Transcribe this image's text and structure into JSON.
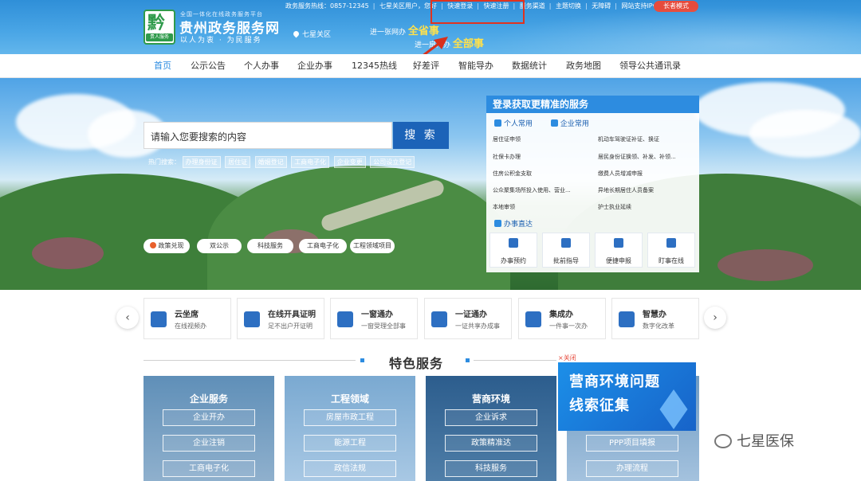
{
  "header": {
    "logo_glyph": "黔",
    "logo_tag": "贵人服务",
    "subtitle": "全国一体化在线政务服务平台",
    "title": "贵州政务服务网",
    "slogan": "以人为衷 · 为民服务",
    "location": "七星关区",
    "slogan_a_prefix": "进一张网办",
    "slogan_a_emph": "全省事",
    "slogan_b_prefix": "进一扇门办",
    "slogan_b_emph": "全部事"
  },
  "topbar": {
    "hotline": "政务服务热线：0857-12345",
    "user": "七星关区用户，您好",
    "quick_login": "快速登录",
    "quick_register": "快速注册",
    "barrier_free": "服务渠道",
    "theme": "主题切换",
    "accessible": "无障碍",
    "ipv6": "网站支持IPv6",
    "elder_mode": "长者模式"
  },
  "nav": [
    "首页",
    "公示公告",
    "个人办事",
    "企业办事",
    "12345热线",
    "好差评",
    "智能导办",
    "数据统计",
    "政务地图",
    "领导公共通讯录"
  ],
  "search": {
    "placeholder": "请输入您要搜索的内容",
    "button": "搜 索",
    "hot_label": "热门搜索：",
    "hot_tags": [
      "办理身份证",
      "居住证",
      "婚姻登记",
      "工商电子化",
      "企业变更",
      "公司设立登记"
    ]
  },
  "pills": [
    "政策兑现",
    "双公示",
    "科技服务",
    "工商电子化",
    "工程领域项目"
  ],
  "panel": {
    "title": "登录获取更精准的服务",
    "tab_personal": "个人常用",
    "tab_company": "企业常用",
    "services_left": [
      "居住证申领",
      "社保卡办理",
      "住房公积金支取",
      "公众聚集场所投入使用、营业...",
      "本地审领"
    ],
    "services_right": [
      "机动车驾驶证补证、换证",
      "居民身份证换领、补发、补领...",
      "缴费人员增减申报",
      "异地长期居住人员备案",
      "护士执业延续"
    ],
    "quick_title": "办事直达",
    "quick": [
      "办事预约",
      "批前指导",
      "便捷申报",
      "盯事在线"
    ]
  },
  "strip": [
    {
      "title": "云坐席",
      "sub": "在线视频办"
    },
    {
      "title": "在线开具证明",
      "sub": "足不出户开证明"
    },
    {
      "title": "一窗通办",
      "sub": "一窗受理全部事"
    },
    {
      "title": "一证通办",
      "sub": "一证共享办成事"
    },
    {
      "title": "集成办",
      "sub": "一件事一次办"
    },
    {
      "title": "智慧办",
      "sub": "数字化改革"
    }
  ],
  "featured": {
    "title": "特色服务",
    "close": "×关闭",
    "columns": [
      {
        "heading": "企业服务",
        "items": [
          "企业开办",
          "企业注销",
          "工商电子化"
        ]
      },
      {
        "heading": "工程领域",
        "items": [
          "房屋市政工程",
          "能源工程",
          "政信法规"
        ]
      },
      {
        "heading": "营商环境",
        "items": [
          "企业诉求",
          "政策精准达",
          "科技服务"
        ]
      },
      {
        "heading": "",
        "items": [
          "PPP项目填报",
          "办理流程"
        ]
      }
    ],
    "promo_line1": "营商环境问题",
    "promo_line2": "线索征集"
  },
  "watermark": "七星医保"
}
